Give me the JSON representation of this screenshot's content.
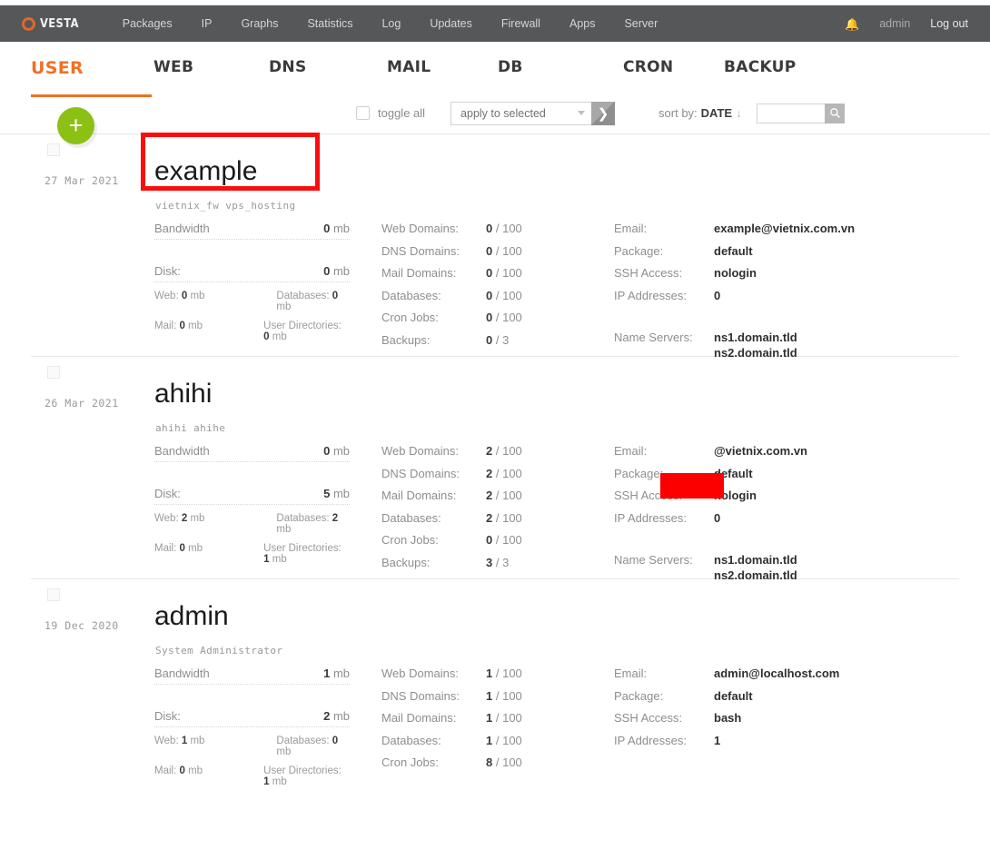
{
  "topbar": {
    "logo_text": "VESTA",
    "nav": [
      {
        "label": "Packages"
      },
      {
        "label": "IP"
      },
      {
        "label": "Graphs"
      },
      {
        "label": "Statistics"
      },
      {
        "label": "Log"
      },
      {
        "label": "Updates"
      },
      {
        "label": "Firewall"
      },
      {
        "label": "Apps"
      },
      {
        "label": "Server"
      }
    ],
    "bell_icon": "bell-icon",
    "user": "admin",
    "logout": "Log out"
  },
  "tabs": [
    {
      "label": "USER",
      "active": true
    },
    {
      "label": "WEB",
      "active": false
    },
    {
      "label": "DNS",
      "active": false
    },
    {
      "label": "MAIL",
      "active": false
    },
    {
      "label": "DB",
      "active": false
    },
    {
      "label": "CRON",
      "active": false
    },
    {
      "label": "BACKUP",
      "active": false
    }
  ],
  "toolbar": {
    "toggle_all_label": "toggle all",
    "apply_select_value": "apply to selected",
    "go_icon": "chevron-right-icon",
    "sort_by_label": "sort by:",
    "sort_by_value": "DATE",
    "sort_arrow": "↓",
    "search_value": "",
    "search_placeholder": "",
    "search_icon": "search-icon"
  },
  "add_button": {
    "icon": "plus-icon",
    "label": "+"
  },
  "colors": {
    "accent": "#ef7125",
    "navbar": "#555759",
    "add_button": "#8dc015",
    "annotation": "#fc0d0d"
  },
  "labels": {
    "bandwidth": "Bandwidth",
    "disk": "Disk:",
    "web": "Web:",
    "databases_mb": "Databases:",
    "mail": "Mail:",
    "user_directories": "User Directories:",
    "web_domains": "Web Domains:",
    "dns_domains": "DNS Domains:",
    "mail_domains": "Mail Domains:",
    "databases": "Databases:",
    "cron_jobs": "Cron Jobs:",
    "backups": "Backups:",
    "email": "Email:",
    "package": "Package:",
    "ssh_access": "SSH Access:",
    "ip_addresses": "IP Addresses:",
    "name_servers": "Name Servers:",
    "mb": "mb"
  },
  "users": [
    {
      "date": "27 Mar 2021",
      "name": "example",
      "subtitle": "vietnix_fw vps_hosting",
      "bandwidth": "0",
      "disk": "0",
      "web_mb": "0",
      "databases_mb": "0",
      "mail_mb": "0",
      "user_dirs_mb": "0",
      "web_domains": "0",
      "web_domains_max": "/ 100",
      "dns_domains": "0",
      "dns_domains_max": "/ 100",
      "mail_domains": "0",
      "mail_domains_max": "/ 100",
      "databases": "0",
      "databases_max": "/ 100",
      "cron_jobs": "0",
      "cron_jobs_max": "/ 100",
      "backups": "0",
      "backups_max": "/ 3",
      "email": "example@vietnix.com.vn",
      "package": "default",
      "ssh_access": "nologin",
      "ip_addresses": "0",
      "ns1": "ns1.domain.tld",
      "ns2": "ns2.domain.tld"
    },
    {
      "date": "26 Mar 2021",
      "name": "ahihi",
      "subtitle": "ahihi ahihe",
      "bandwidth": "0",
      "disk": "5",
      "web_mb": "2",
      "databases_mb": "2",
      "mail_mb": "0",
      "user_dirs_mb": "1",
      "web_domains": "2",
      "web_domains_max": "/ 100",
      "dns_domains": "2",
      "dns_domains_max": "/ 100",
      "mail_domains": "2",
      "mail_domains_max": "/ 100",
      "databases": "2",
      "databases_max": "/ 100",
      "cron_jobs": "0",
      "cron_jobs_max": "/ 100",
      "backups": "3",
      "backups_max": "/ 3",
      "email": "@vietnix.com.vn",
      "package": "default",
      "ssh_access": "nologin",
      "ip_addresses": "0",
      "ns1": "ns1.domain.tld",
      "ns2": "ns2.domain.tld"
    },
    {
      "date": "19 Dec 2020",
      "name": "admin",
      "subtitle": "System Administrator",
      "bandwidth": "1",
      "disk": "2",
      "web_mb": "1",
      "databases_mb": "0",
      "mail_mb": "0",
      "user_dirs_mb": "1",
      "web_domains": "1",
      "web_domains_max": "/ 100",
      "dns_domains": "1",
      "dns_domains_max": "/ 100",
      "mail_domains": "1",
      "mail_domains_max": "/ 100",
      "databases": "1",
      "databases_max": "/ 100",
      "cron_jobs": "8",
      "cron_jobs_max": "/ 100",
      "backups": "",
      "backups_max": "",
      "email": "admin@localhost.com",
      "package": "default",
      "ssh_access": "bash",
      "ip_addresses": "1",
      "ns1": "",
      "ns2": ""
    }
  ]
}
